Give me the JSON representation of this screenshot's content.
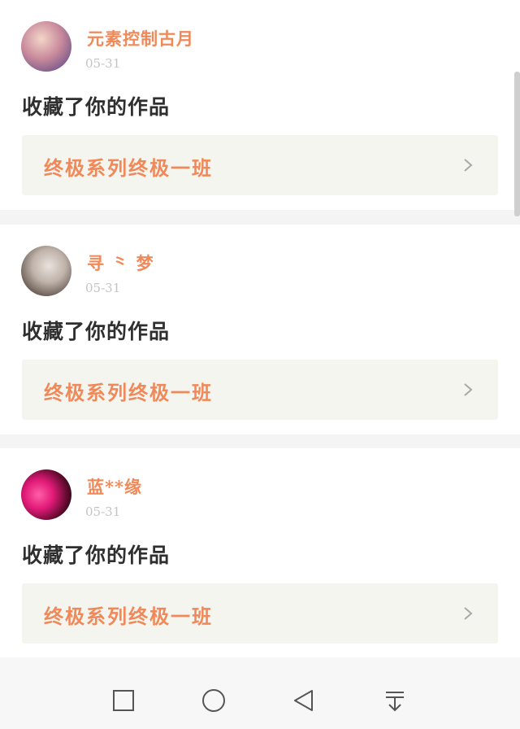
{
  "feed": [
    {
      "username": "元素控制古月",
      "time": "05-31",
      "action": "收藏了你的作品",
      "work_title": "终极系列终极一班"
    },
    {
      "username": "寻 ⺀ 梦",
      "time": "05-31",
      "action": "收藏了你的作品",
      "work_title": "终极系列终极一班"
    },
    {
      "username": "蓝**缘",
      "time": "05-31",
      "action": "收藏了你的作品",
      "work_title": "终极系列终极一班"
    }
  ],
  "colors": {
    "accent": "#f0895a",
    "card_bg": "#ffffff",
    "work_bg": "#f5f5f0",
    "timestamp": "#c4c4c4"
  },
  "navbar": {
    "icons": [
      "square-icon",
      "circle-icon",
      "back-triangle-icon",
      "notification-pull-icon"
    ]
  }
}
